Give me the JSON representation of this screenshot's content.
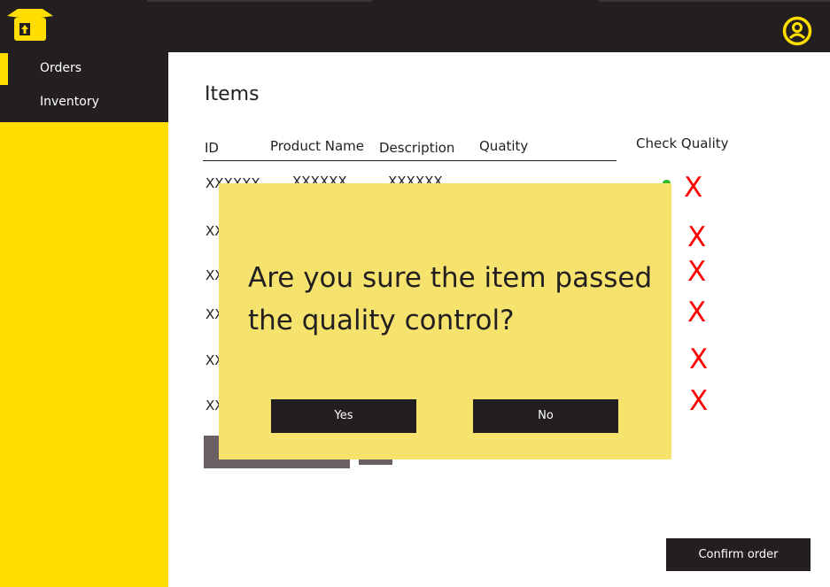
{
  "nav": {
    "items": [
      {
        "label": "Orders",
        "active": true
      },
      {
        "label": "Inventory",
        "active": false
      }
    ]
  },
  "page": {
    "title": "Items"
  },
  "table": {
    "columns": [
      "ID",
      "Product Name",
      "Description",
      "Quatity",
      "Check Quality"
    ],
    "rows": [
      {
        "id": "XXXXXX",
        "name": "XXXXXX",
        "description": "XXXXXX"
      },
      {
        "id": "XX"
      },
      {
        "id": "XX"
      },
      {
        "id": "XX"
      },
      {
        "id": "XX"
      },
      {
        "id": "XX"
      }
    ],
    "reject_symbol": "X"
  },
  "modal": {
    "question": "Are you sure the item passed the quality control?",
    "yes_label": "Yes",
    "no_label": "No"
  },
  "footer": {
    "confirm_label": "Confirm order"
  },
  "colors": {
    "dark": "#231f20",
    "yellow": "#ffde00",
    "modal_bg": "#f6e36d",
    "reject_red": "#ff0000",
    "pass_green": "#2dbb2d"
  },
  "icons": {
    "logo": "box-upload-icon",
    "user": "user-circle-icon",
    "pass": "check-icon",
    "reject": "x-icon"
  }
}
